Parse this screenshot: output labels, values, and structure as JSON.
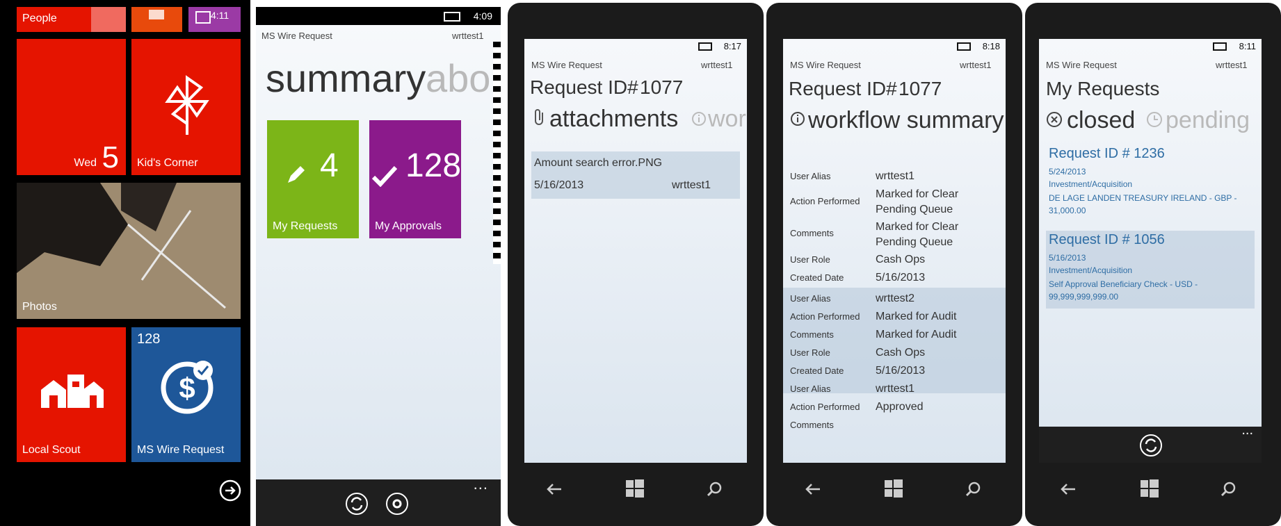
{
  "phone1": {
    "time": "4:11",
    "tiles": {
      "people": "People",
      "calendar_day": "Wed",
      "calendar_date": "5",
      "kids_corner": "Kid's Corner",
      "photos": "Photos",
      "local_scout": "Local Scout",
      "wire_count": "128",
      "wire_label": "MS Wire Request"
    },
    "arrow_icon": "arrow-right-circle-icon"
  },
  "phone2": {
    "time": "4:09",
    "app_title": "MS Wire Request",
    "user": "wrttest1",
    "pivot_active": "summary",
    "pivot_next": "abou",
    "tiles": [
      {
        "count": "4",
        "label": "My Requests",
        "icon": "pencil-icon",
        "color": "#7cb518"
      },
      {
        "count": "128",
        "label": "My Approvals",
        "icon": "check-icon",
        "color": "#8b1a8b"
      }
    ],
    "appbar_more": "..."
  },
  "phone3": {
    "time": "8:17",
    "app_title": "MS Wire Request",
    "user": "wrttest1",
    "request_label": "Request ID#",
    "request_id": "1077",
    "pivot_active": "attachments",
    "pivot_next": "wor",
    "attachment": {
      "name": "Amount search error.PNG",
      "date": "5/16/2013",
      "user": "wrttest1"
    }
  },
  "phone4": {
    "time": "8:18",
    "app_title": "MS Wire Request",
    "user": "wrttest1",
    "request_label": "Request ID#",
    "request_id": "1077",
    "pivot_active": "workflow summary",
    "rows": [
      {
        "k": "User Alias",
        "v": "wrttest1"
      },
      {
        "k": "Action Performed",
        "v": "Marked for Clear Pending Queue"
      },
      {
        "k": "Comments",
        "v": "Marked for Clear Pending Queue"
      },
      {
        "k": "User Role",
        "v": "Cash Ops"
      },
      {
        "k": "Created Date",
        "v": "5/16/2013"
      },
      {
        "k": "User Alias",
        "v": "wrttest2"
      },
      {
        "k": "Action Performed",
        "v": "Marked for Audit"
      },
      {
        "k": "Comments",
        "v": "Marked for Audit"
      },
      {
        "k": "User Role",
        "v": "Cash Ops"
      },
      {
        "k": "Created Date",
        "v": "5/16/2013"
      },
      {
        "k": "User Alias",
        "v": "wrttest1"
      },
      {
        "k": "Action Performed",
        "v": "Approved"
      },
      {
        "k": "Comments",
        "v": ""
      }
    ]
  },
  "phone5": {
    "time": "8:11",
    "app_title": "MS Wire Request",
    "user": "wrttest1",
    "page_title": "My Requests",
    "pivot_active": "closed",
    "pivot_next": "pending",
    "requests": [
      {
        "title": "Request ID # 1236",
        "date": "5/24/2013",
        "category": "Investment/Acquisition",
        "detail": "DE LAGE LANDEN TREASURY IRELAND - GBP - 31,000.00"
      },
      {
        "title": "Request ID # 1056",
        "date": "5/16/2013",
        "category": "Investment/Acquisition",
        "detail": "Self Approval Beneficiary Check - USD - 99,999,999,999.00"
      }
    ],
    "appbar_more": "..."
  }
}
